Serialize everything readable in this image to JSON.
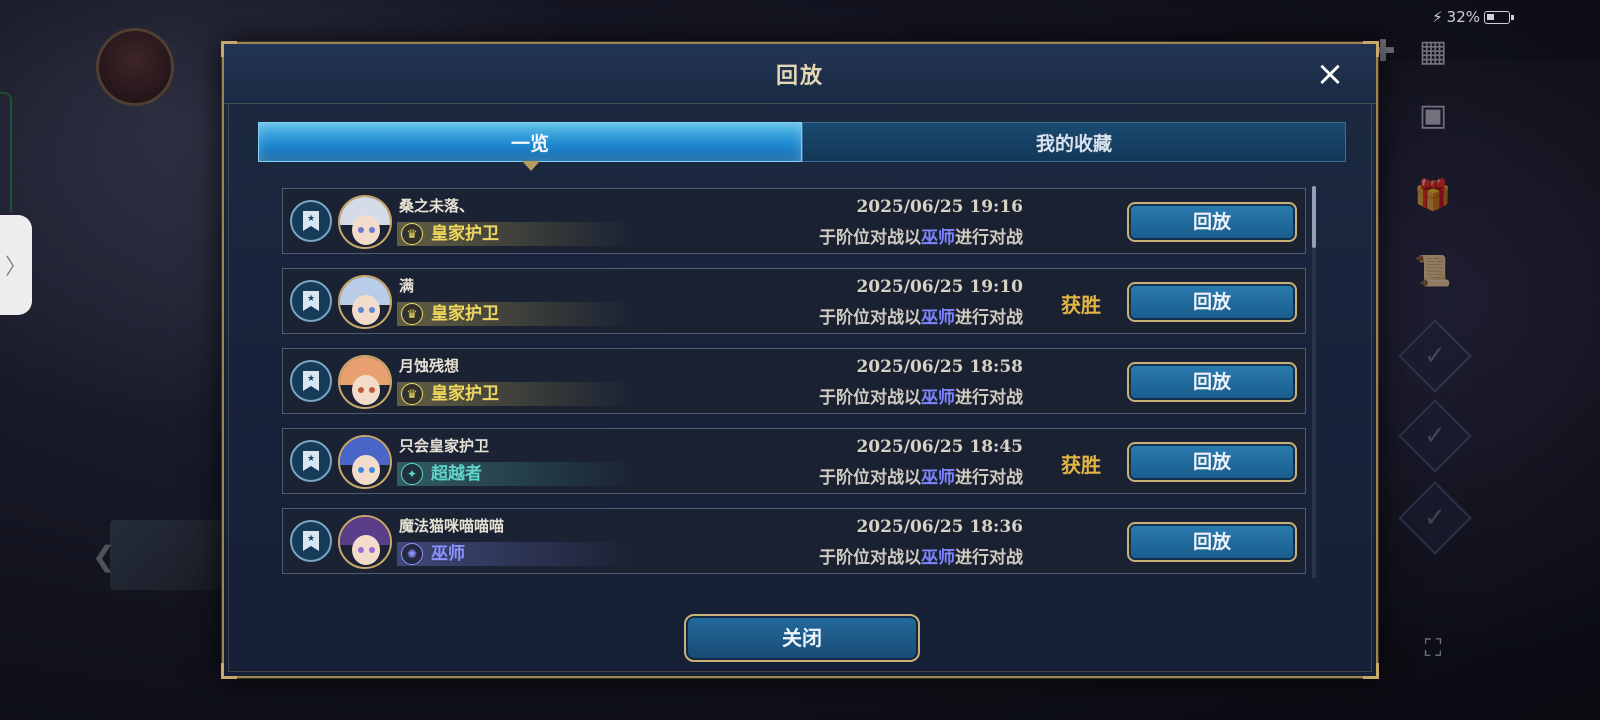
{
  "status_bar": {
    "battery": "32%"
  },
  "modal": {
    "title": "回放",
    "close_icon": "×",
    "tabs": [
      {
        "label": "一览",
        "active": true
      },
      {
        "label": "我的收藏",
        "active": false
      }
    ],
    "rows": [
      {
        "player": "桑之未落、",
        "class": "皇家护卫",
        "class_color": "#f0d860",
        "datetime": "2025/06/25  19:16",
        "desc_prefix": "于阶位对战以",
        "desc_class": "巫师",
        "desc_suffix": "进行对战",
        "result": "",
        "button": "回放",
        "avatar_hair": "#d6dbe8",
        "avatar_eye": "#6a7ad8"
      },
      {
        "player": "满",
        "class": "皇家护卫",
        "class_color": "#f0d860",
        "datetime": "2025/06/25  19:10",
        "desc_prefix": "于阶位对战以",
        "desc_class": "巫师",
        "desc_suffix": "进行对战",
        "result": "获胜",
        "button": "回放",
        "avatar_hair": "#b9cde8",
        "avatar_eye": "#5a8ad8"
      },
      {
        "player": "月蚀残想",
        "class": "皇家护卫",
        "class_color": "#f0d860",
        "datetime": "2025/06/25  18:58",
        "desc_prefix": "于阶位对战以",
        "desc_class": "巫师",
        "desc_suffix": "进行对战",
        "result": "",
        "button": "回放",
        "avatar_hair": "#e8a070",
        "avatar_eye": "#c25a3a"
      },
      {
        "player": "只会皇家护卫",
        "class": "超越者",
        "class_color": "#5fd4c8",
        "datetime": "2025/06/25  18:45",
        "desc_prefix": "于阶位对战以",
        "desc_class": "巫师",
        "desc_suffix": "进行对战",
        "result": "获胜",
        "button": "回放",
        "avatar_hair": "#4a66c8",
        "avatar_eye": "#3a8ae0"
      },
      {
        "player": "魔法猫咪喵喵喵",
        "class": "巫师",
        "class_color": "#8c93ff",
        "datetime": "2025/06/25  18:36",
        "desc_prefix": "于阶位对战以",
        "desc_class": "巫师",
        "desc_suffix": "进行对战",
        "result": "",
        "button": "回放",
        "avatar_hair": "#5a3e8a",
        "avatar_eye": "#9a6ae0"
      }
    ],
    "footer_button": "关闭"
  }
}
